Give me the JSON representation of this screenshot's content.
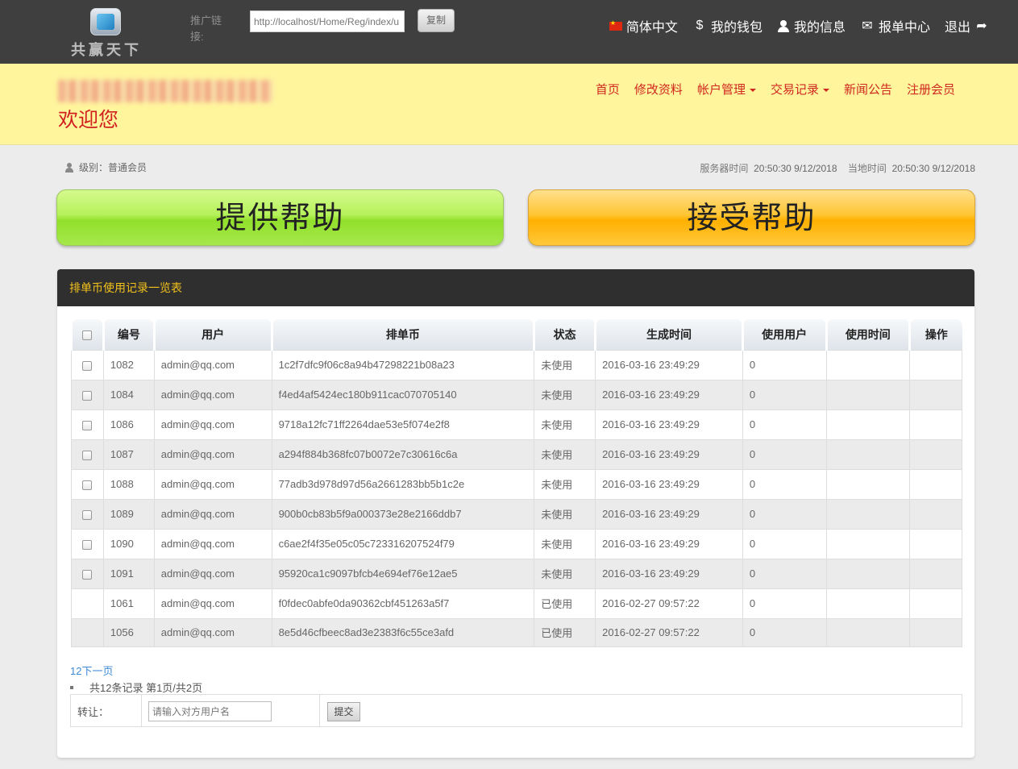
{
  "header": {
    "logo_text": "共赢天下",
    "promo_label": "推广链接:",
    "promo_value": "http://localhost/Home/Reg/index/u",
    "copy_label": "复制",
    "links": [
      {
        "label": "简体中文",
        "icon": "china-flag-icon"
      },
      {
        "label": "我的钱包",
        "icon": "dollar-icon",
        "glyph": "$"
      },
      {
        "label": "我的信息",
        "icon": "user-icon",
        "glyph": "👤"
      },
      {
        "label": "报单中心",
        "icon": "envelope-icon",
        "glyph": "✉"
      },
      {
        "label": "退出",
        "icon": "share-arrow-icon",
        "glyph": "➦"
      }
    ]
  },
  "banner": {
    "welcome": "欢迎您",
    "nav": [
      {
        "label": "首页"
      },
      {
        "label": "修改资料"
      },
      {
        "label": "帐户管理",
        "dropdown": true
      },
      {
        "label": "交易记录",
        "dropdown": true
      },
      {
        "label": "新闻公告"
      },
      {
        "label": "注册会员"
      }
    ]
  },
  "info": {
    "level_label": "级别：",
    "level_value": "普通会员",
    "server_time_label": "服务器时间",
    "server_time": "20:50:30 9/12/2018",
    "local_time_label": "当地时间",
    "local_time": "20:50:30 9/12/2018"
  },
  "actions": {
    "provide_help": "提供帮助",
    "accept_help": "接受帮助"
  },
  "panel": {
    "title": "排单币使用记录一览表",
    "columns": [
      "",
      "编号",
      "用户",
      "排单币",
      "状态",
      "生成时间",
      "使用用户",
      "使用时间",
      "操作"
    ],
    "rows": [
      {
        "checkbox": true,
        "id": "1082",
        "user": "admin@qq.com",
        "coin": "1c2f7dfc9f06c8a94b47298221b08a23",
        "status": "未使用",
        "created": "2016-03-16 23:49:29",
        "used_by": "0",
        "used_at": "",
        "op": ""
      },
      {
        "checkbox": true,
        "id": "1084",
        "user": "admin@qq.com",
        "coin": "f4ed4af5424ec180b911cac070705140",
        "status": "未使用",
        "created": "2016-03-16 23:49:29",
        "used_by": "0",
        "used_at": "",
        "op": ""
      },
      {
        "checkbox": true,
        "id": "1086",
        "user": "admin@qq.com",
        "coin": "9718a12fc71ff2264dae53e5f074e2f8",
        "status": "未使用",
        "created": "2016-03-16 23:49:29",
        "used_by": "0",
        "used_at": "",
        "op": ""
      },
      {
        "checkbox": true,
        "id": "1087",
        "user": "admin@qq.com",
        "coin": "a294f884b368fc07b0072e7c30616c6a",
        "status": "未使用",
        "created": "2016-03-16 23:49:29",
        "used_by": "0",
        "used_at": "",
        "op": ""
      },
      {
        "checkbox": true,
        "id": "1088",
        "user": "admin@qq.com",
        "coin": "77adb3d978d97d56a2661283bb5b1c2e",
        "status": "未使用",
        "created": "2016-03-16 23:49:29",
        "used_by": "0",
        "used_at": "",
        "op": ""
      },
      {
        "checkbox": true,
        "id": "1089",
        "user": "admin@qq.com",
        "coin": "900b0cb83b5f9a000373e28e2166ddb7",
        "status": "未使用",
        "created": "2016-03-16 23:49:29",
        "used_by": "0",
        "used_at": "",
        "op": ""
      },
      {
        "checkbox": true,
        "id": "1090",
        "user": "admin@qq.com",
        "coin": "c6ae2f4f35e05c05c723316207524f79",
        "status": "未使用",
        "created": "2016-03-16 23:49:29",
        "used_by": "0",
        "used_at": "",
        "op": ""
      },
      {
        "checkbox": true,
        "id": "1091",
        "user": "admin@qq.com",
        "coin": "95920ca1c9097bfcb4e694ef76e12ae5",
        "status": "未使用",
        "created": "2016-03-16 23:49:29",
        "used_by": "0",
        "used_at": "",
        "op": ""
      },
      {
        "checkbox": false,
        "id": "1061",
        "user": "admin@qq.com",
        "coin": "f0fdec0abfe0da90362cbf451263a5f7",
        "status": "已使用",
        "created": "2016-02-27 09:57:22",
        "used_by": "0",
        "used_at": "",
        "op": ""
      },
      {
        "checkbox": false,
        "id": "1056",
        "user": "admin@qq.com",
        "coin": "8e5d46cfbeec8ad3e2383f6c55ce3afd",
        "status": "已使用",
        "created": "2016-02-27 09:57:22",
        "used_by": "0",
        "used_at": "",
        "op": ""
      }
    ],
    "pager": "12下一页",
    "record_count": "共12条记录 第1页/共2页",
    "transfer_label": "转让：",
    "transfer_placeholder": "请输入对方用户名",
    "submit_label": "提交"
  },
  "colors": {
    "topbar": "#3f3f3f",
    "banner": "#fff59d",
    "nav_red": "#d0281e",
    "provide_green": "#b5f15a",
    "accept_orange": "#ffc533",
    "panel_title": "#f3c21b"
  }
}
